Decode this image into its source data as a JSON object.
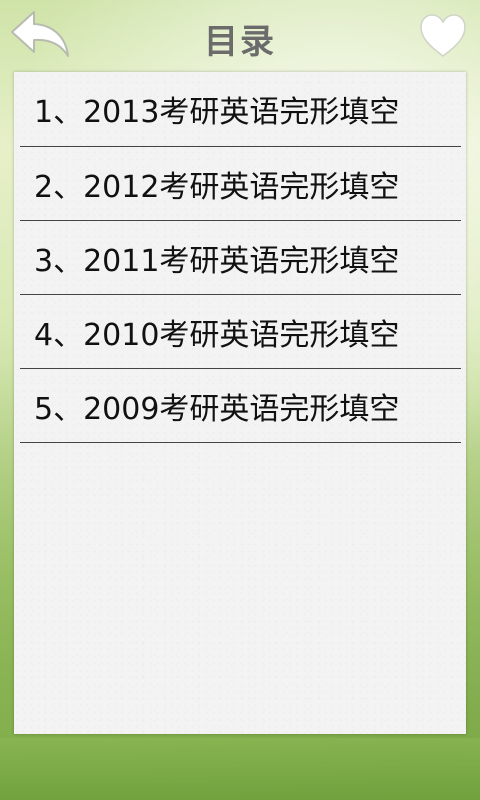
{
  "header": {
    "title": "目录",
    "back_icon": "back-arrow-icon",
    "favorite_icon": "heart-icon"
  },
  "list": {
    "items": [
      {
        "label": "1、2013考研英语完形填空"
      },
      {
        "label": "2、2012考研英语完形填空"
      },
      {
        "label": "3、2011考研英语完形填空"
      },
      {
        "label": "4、2010考研英语完形填空"
      },
      {
        "label": "5、2009考研英语完形填空"
      }
    ]
  },
  "colors": {
    "title": "#6b6b6b",
    "panel": "#f3f3f3",
    "divider": "#444444",
    "background_green": "#a9c978"
  }
}
